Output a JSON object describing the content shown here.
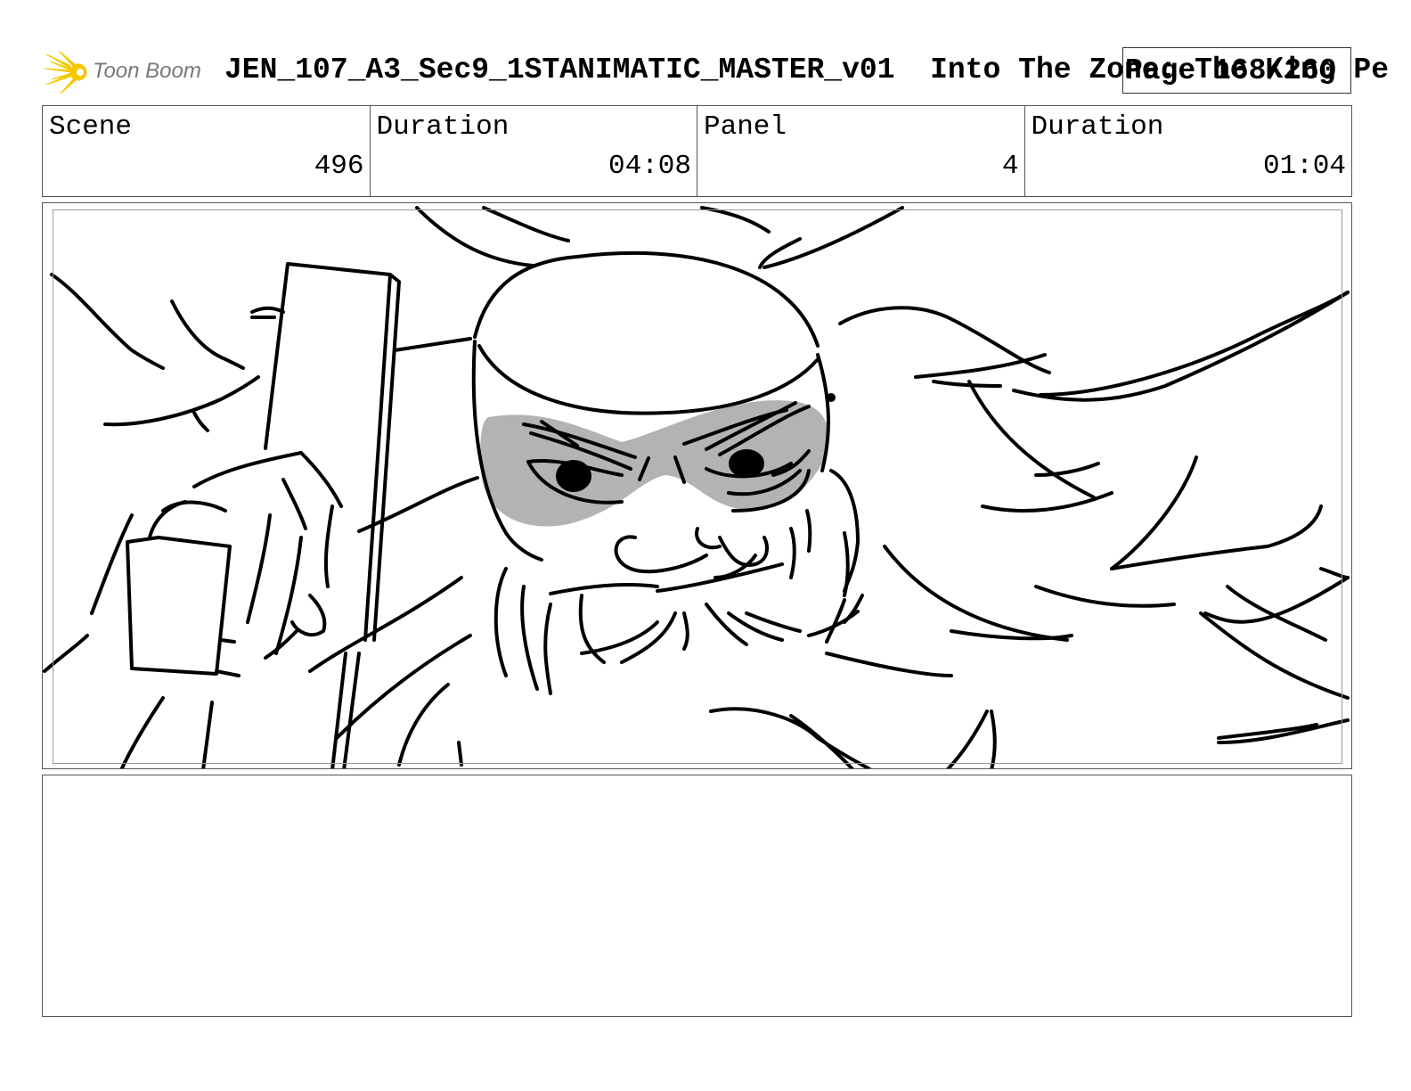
{
  "header": {
    "logo_text": "Toon Boom",
    "title": "JEN_107_A3_Sec9_1STANIMATIC_MASTER_v01  Into The Zone: The King Pe",
    "page_label": "Page 168/260"
  },
  "info": {
    "scene_label": "Scene",
    "scene_value": "496",
    "scene_duration_label": "Duration",
    "scene_duration_value": "04:08",
    "panel_label": "Panel",
    "panel_value": "4",
    "panel_duration_label": "Duration",
    "panel_duration_value": "01:04"
  },
  "panel": {
    "image_icon": "storyboard-sketch-image",
    "mask_color": "#b3b3b3"
  },
  "colors": {
    "logo_sun": "#f5c800",
    "logo_text": "#777777",
    "frame_border": "#555555",
    "safe_frame": "#9a9a9a"
  }
}
